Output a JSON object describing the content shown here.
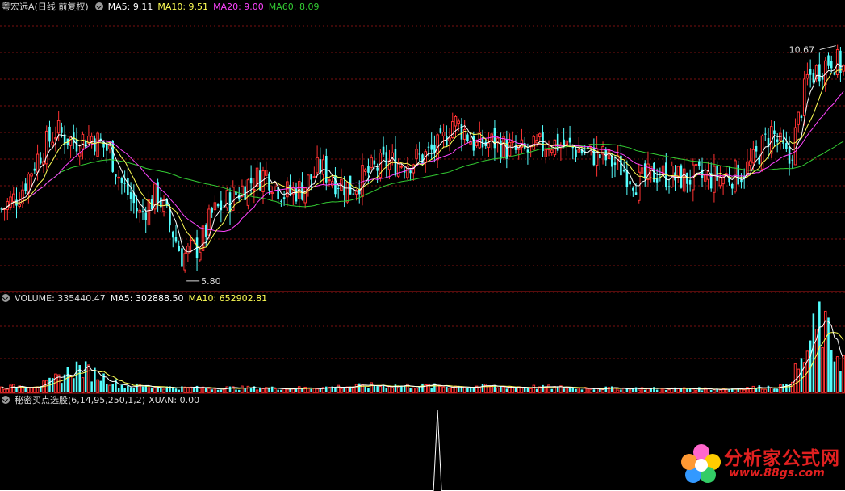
{
  "header": {
    "stock": "粤宏远A",
    "period": "(日线 前复权)",
    "ma5": "MA5: 9.11",
    "ma10": "MA10: 9.51",
    "ma20": "MA20: 9.00",
    "ma60": "MA60: 8.09"
  },
  "volume_header": {
    "volume": "VOLUME: 335440.47",
    "ma5": "MA5: 302888.50",
    "ma10": "MA10: 652902.81"
  },
  "indicator_header": {
    "name": "秘密买点选股(6,14,95,250,1,2)",
    "xuan": "XUAN: 0.00"
  },
  "annotations": {
    "high": "10.67",
    "low": "5.80"
  },
  "watermark": {
    "text": "分析家公式网",
    "url": "www.88gs.com"
  },
  "colors": {
    "up": "#ff3232",
    "down": "#54ffff",
    "ma5": "#ffffff",
    "ma10": "#ffff55",
    "ma20": "#ff44ff",
    "ma60": "#33cc33",
    "grid": "#7a1010",
    "divider": "#b01818"
  },
  "chart_data": [
    {
      "type": "candlestick",
      "title": "粤宏远A (日线 前复权)",
      "ylim": [
        5.6,
        10.9
      ],
      "annotated_high": 10.67,
      "annotated_low": 5.8,
      "close_path": [
        [
          0,
          7.1
        ],
        [
          6,
          7.4
        ],
        [
          12,
          8.1
        ],
        [
          18,
          8.6
        ],
        [
          24,
          8.4
        ],
        [
          30,
          8.5
        ],
        [
          36,
          8.2
        ],
        [
          40,
          7.6
        ],
        [
          46,
          7.0
        ],
        [
          52,
          7.4
        ],
        [
          56,
          6.8
        ],
        [
          60,
          6.2
        ],
        [
          66,
          6.4
        ],
        [
          70,
          7.0
        ],
        [
          76,
          7.3
        ],
        [
          82,
          7.6
        ],
        [
          88,
          7.8
        ],
        [
          94,
          7.4
        ],
        [
          100,
          7.5
        ],
        [
          106,
          7.9
        ],
        [
          110,
          7.7
        ],
        [
          116,
          7.5
        ],
        [
          122,
          7.8
        ],
        [
          128,
          8.0
        ],
        [
          134,
          8.0
        ],
        [
          140,
          8.1
        ],
        [
          146,
          8.3
        ],
        [
          150,
          8.8
        ],
        [
          154,
          8.6
        ],
        [
          158,
          8.3
        ],
        [
          164,
          8.4
        ],
        [
          170,
          8.2
        ],
        [
          176,
          8.2
        ],
        [
          182,
          8.4
        ],
        [
          188,
          8.3
        ],
        [
          194,
          8.2
        ],
        [
          200,
          8.1
        ],
        [
          206,
          7.9
        ],
        [
          212,
          7.6
        ],
        [
          218,
          7.8
        ],
        [
          224,
          7.7
        ],
        [
          232,
          7.7
        ],
        [
          238,
          7.7
        ],
        [
          246,
          7.8
        ],
        [
          250,
          8.0
        ],
        [
          256,
          8.6
        ],
        [
          262,
          8.0
        ],
        [
          268,
          9.6
        ],
        [
          272,
          9.8
        ],
        [
          276,
          10.0
        ],
        [
          280,
          9.8
        ]
      ],
      "ma5": 9.11,
      "ma10": 9.51,
      "ma20": 9.0,
      "ma60": 8.09
    },
    {
      "type": "bar",
      "title": "VOLUME",
      "volume": 335440.47,
      "ma5": 302888.5,
      "ma10": 652902.81,
      "ylim": [
        0,
        1100000
      ],
      "profile": [
        [
          0,
          60000
        ],
        [
          15,
          110000
        ],
        [
          25,
          320000
        ],
        [
          32,
          230000
        ],
        [
          40,
          90000
        ],
        [
          60,
          60000
        ],
        [
          100,
          55000
        ],
        [
          125,
          90000
        ],
        [
          150,
          80000
        ],
        [
          175,
          70000
        ],
        [
          200,
          55000
        ],
        [
          240,
          45000
        ],
        [
          260,
          80000
        ],
        [
          266,
          350000
        ],
        [
          272,
          900000
        ],
        [
          276,
          600000
        ],
        [
          280,
          400000
        ]
      ]
    },
    {
      "type": "line",
      "title": "秘密买点选股(6,14,95,250,1,2)",
      "series": [
        {
          "name": "XUAN",
          "value": 0.0,
          "spike_index": 145,
          "spike": 1
        }
      ]
    }
  ]
}
